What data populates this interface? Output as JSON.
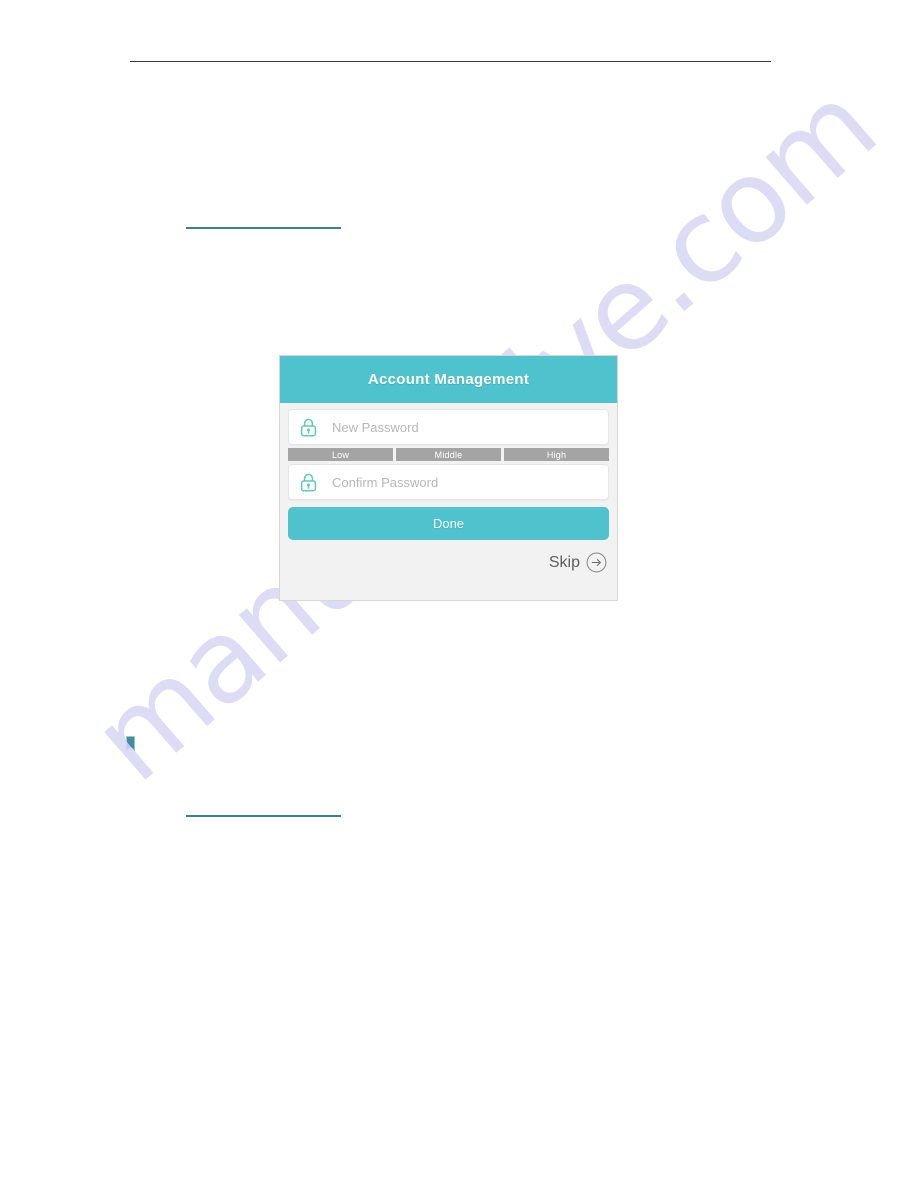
{
  "page": {
    "document_type": "manual-page",
    "background_color": "#ffffff",
    "header_rule_color": "#3a3a3c",
    "section_rule_color": "#3f7f92",
    "bookmark_icon": "bookmark-icon"
  },
  "watermark": {
    "text": "manualshive.com",
    "color": "#d7d7f4"
  },
  "app": {
    "header": {
      "title": "Account Management",
      "background_color": "#4ec3ce",
      "text_color": "#ffffff"
    },
    "fields": [
      {
        "name": "new-password",
        "icon": "lock-icon",
        "placeholder": "New Password",
        "value": ""
      },
      {
        "name": "confirm-password",
        "icon": "lock-icon",
        "placeholder": "Confirm Password",
        "value": ""
      }
    ],
    "password_strength": {
      "segments": [
        {
          "label": "Low",
          "color": "#a4a4a4"
        },
        {
          "label": "Middle",
          "color": "#a4a4a4"
        },
        {
          "label": "High",
          "color": "#a4a4a4"
        }
      ]
    },
    "done_button": {
      "label": "Done",
      "color": "#4ec3ce"
    },
    "skip_link": {
      "label": "Skip",
      "icon": "arrow-right-circle-icon"
    }
  }
}
